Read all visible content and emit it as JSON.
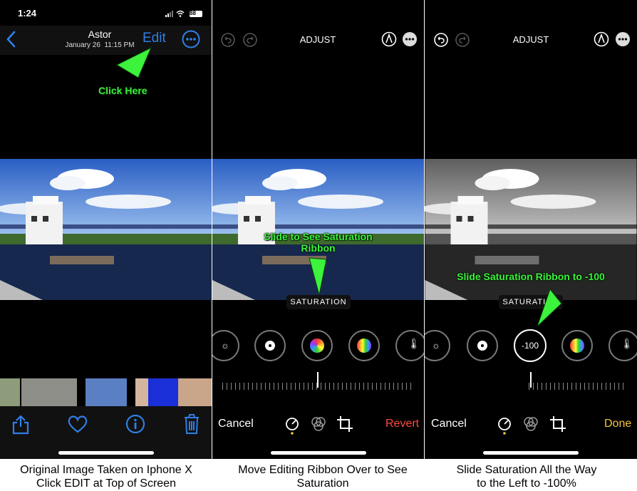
{
  "status_bar": {
    "time": "1:24",
    "battery": "88"
  },
  "photos_header": {
    "title": "Astor",
    "subtitle": "January 26  11:15 PM",
    "edit_label": "Edit"
  },
  "adjust_header": {
    "title": "ADJUST"
  },
  "annotations": {
    "click_here": "Click Here",
    "slide_to_see_line1": "Slide to See Saturation",
    "slide_to_see_line2": "Ribbon",
    "slide_saturation": "Slide Saturation Ribbon to -100"
  },
  "editor": {
    "tool_label": "SATURATION",
    "saturation_value": "-100",
    "saturation_level": -100,
    "cancel": "Cancel",
    "revert": "Revert",
    "done": "Done"
  },
  "captions": {
    "panel1": [
      "Original Image Taken on Iphone X",
      "Click EDIT at Top of Screen"
    ],
    "panel2": [
      "Move Editing Ribbon Over to See",
      "Saturation"
    ],
    "panel3": [
      "Slide Saturation All the Way",
      "to the Left to -100%"
    ]
  },
  "colors": {
    "ios_blue": "#2f7fe6",
    "annotation_green": "#3cf23c",
    "revert_red": "#ff4a3d",
    "done_yellow": "#f5c542"
  },
  "icons": [
    "back-chevron-icon",
    "more-icon",
    "share-icon",
    "heart-icon",
    "info-icon",
    "trash-icon",
    "undo-icon",
    "redo-icon",
    "markup-icon",
    "adjust-icon",
    "filters-icon",
    "crop-icon"
  ]
}
